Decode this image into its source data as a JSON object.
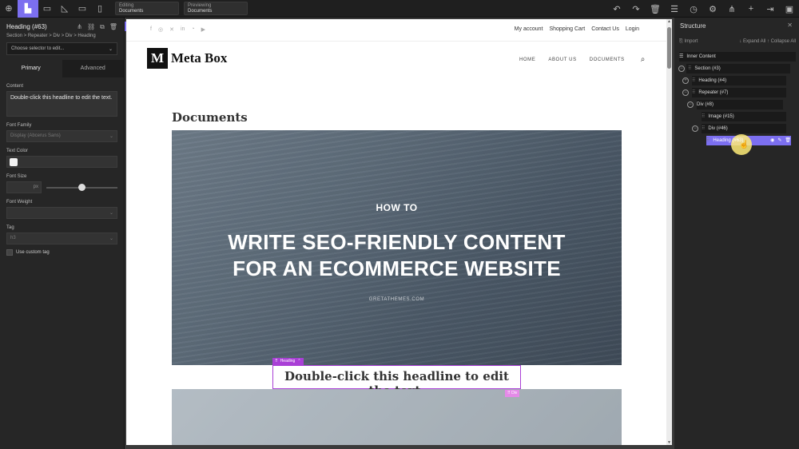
{
  "toolbar": {
    "editing_caption": "Editing",
    "editing_value": "Documents",
    "previewing_caption": "Previewing",
    "previewing_value": "Documents"
  },
  "left_panel": {
    "title": "Heading (#63)",
    "breadcrumb": "Section > Repeater > Div > Div > Heading",
    "selector_placeholder": "Choose selector to edit...",
    "tabs": [
      "Primary",
      "Advanced"
    ],
    "content_label": "Content",
    "content_value": "Double-click this headline to edit the text.",
    "font_family_label": "Font Family",
    "font_family_value": "Display (Abcerus Sans)",
    "text_color_label": "Text Color",
    "font_size_label": "Font Size",
    "font_size_unit": "px",
    "font_size_value": 50,
    "font_weight_label": "Font Weight",
    "tag_label": "Tag",
    "tag_value": "h3",
    "custom_tag_label": "Use custom tag"
  },
  "page": {
    "top_links": [
      "My account",
      "Shopping Cart",
      "Contact Us",
      "Login"
    ],
    "social_icons": [
      "facebook-icon",
      "instagram-icon",
      "x-icon",
      "linkedin-icon",
      "rss-icon",
      "youtube-icon"
    ],
    "logo_mark": "M",
    "logo_text": "Meta Box",
    "nav": [
      "HOME",
      "ABOUT US",
      "DOCUMENTS"
    ],
    "section_title": "Documents",
    "hero_kicker": "HOW TO",
    "hero_title": "WRITE SEO-FRIENDLY CONTENT FOR AN ECOMMERCE WEBSITE",
    "hero_site": "GRETATHEMES.COM",
    "selected_tag_label": "Heading",
    "headline": "Double-click this headline to edit the text.",
    "div_tag_label": "Div"
  },
  "structure": {
    "title": "Structure",
    "import_label": "Import",
    "expand_label": "Expand All",
    "collapse_label": "Collapse All",
    "items": [
      {
        "label": "Inner Content"
      },
      {
        "label": "Section (#3)"
      },
      {
        "label": "Heading (#4)"
      },
      {
        "label": "Repeater (#7)"
      },
      {
        "label": "Div (#8)"
      },
      {
        "label": "Image (#15)"
      },
      {
        "label": "Div (#46)"
      },
      {
        "label": "Heading (#63)"
      }
    ]
  },
  "colors": {
    "accent": "#7c6ff0",
    "selection": "#a93fd6",
    "div_badge": "#e58ae8"
  }
}
